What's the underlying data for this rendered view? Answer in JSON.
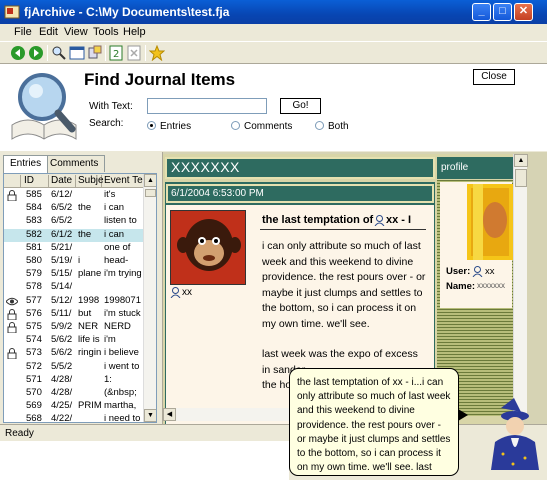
{
  "window": {
    "title": "fjArchive - C:\\My Documents\\test.fja"
  },
  "titlebar_buttons": {
    "minimize": "_",
    "maximize": "□",
    "close": "✕"
  },
  "menu": {
    "file": "File",
    "edit": "Edit",
    "view": "View",
    "tools": "Tools",
    "help": "Help"
  },
  "find": {
    "title": "Find Journal Items",
    "with_text_label": "With Text:",
    "text_value": "",
    "go_label": "Go!",
    "close_label": "Close",
    "search_label": "Search:",
    "options": {
      "entries": "Entries",
      "comments": "Comments",
      "both": "Both"
    },
    "selected": "Entries"
  },
  "tabs": {
    "entries": "Entries",
    "comments": "Comments"
  },
  "list": {
    "columns": {
      "id": "ID",
      "date": "Date",
      "subject": "Subje",
      "event": "Event Te"
    },
    "rows": [
      {
        "icon": "lock",
        "id": "585",
        "date": "6/12/",
        "subject": "",
        "event": "it's"
      },
      {
        "icon": "",
        "id": "584",
        "date": "6/5/2",
        "subject": "the",
        "event": "i can"
      },
      {
        "icon": "",
        "id": "583",
        "date": "6/5/2",
        "subject": "",
        "event": "listen to"
      },
      {
        "icon": "",
        "id": "582",
        "date": "6/1/2",
        "subject": "the",
        "event": "i can"
      },
      {
        "icon": "",
        "id": "581",
        "date": "5/21/",
        "subject": "",
        "event": "one of"
      },
      {
        "icon": "",
        "id": "580",
        "date": "5/19/",
        "subject": "i",
        "event": "head-"
      },
      {
        "icon": "",
        "id": "579",
        "date": "5/15/",
        "subject": "plane",
        "event": "i'm trying"
      },
      {
        "icon": "",
        "id": "578",
        "date": "5/14/",
        "subject": "",
        "event": ""
      },
      {
        "icon": "eye",
        "id": "577",
        "date": "5/12/",
        "subject": "1998",
        "event": "1998071"
      },
      {
        "icon": "lock",
        "id": "576",
        "date": "5/11/",
        "subject": "but",
        "event": "i'm stuck"
      },
      {
        "icon": "lock",
        "id": "575",
        "date": "5/9/2",
        "subject": "NER",
        "event": "NERD"
      },
      {
        "icon": "",
        "id": "574",
        "date": "5/6/2",
        "subject": "life is",
        "event": "i'm"
      },
      {
        "icon": "lock",
        "id": "573",
        "date": "5/6/2",
        "subject": "ringin",
        "event": "i believe"
      },
      {
        "icon": "",
        "id": "572",
        "date": "5/5/2",
        "subject": "",
        "event": "i went to"
      },
      {
        "icon": "",
        "id": "571",
        "date": "4/28/",
        "subject": "",
        "event": "1:"
      },
      {
        "icon": "",
        "id": "570",
        "date": "4/28/",
        "subject": "",
        "event": "(&nbsp;"
      },
      {
        "icon": "",
        "id": "569",
        "date": "4/25/",
        "subject": "PRIM",
        "event": "martha,"
      },
      {
        "icon": "",
        "id": "568",
        "date": "4/22/",
        "subject": "",
        "event": "i need to"
      }
    ],
    "selected_id": "582"
  },
  "journal": {
    "header": "XXXXXXX",
    "profile_tab": "profile",
    "entry_date": "6/1/2004 6:53:00 PM",
    "entry_title": "the last temptation of",
    "entry_title_user": "xx - I",
    "avatar_user": "xx",
    "entry_text": "i can only attribute so much of last week and this weekend to divine providence. the rest pours over - or maybe it just clumps and settles to the bottom, so i can process it on my own time. we'll see.",
    "entry_text_2": "last week was the expo of excess in sandar",
    "entry_text_3": "the hot",
    "profile_user_label": "User:",
    "profile_user": "xx",
    "profile_name_label": "Name:",
    "profile_name": "xxxxxxx"
  },
  "tooltip": {
    "text": "the last temptation of xx - i...i can only attribute so much of last week and this weekend to divine providence. the rest pours over - or maybe it just clumps and settles to the bottom, so i can process it on my own time. we'll see. last"
  },
  "status": {
    "text": "Ready"
  },
  "colors": {
    "titlebar": "#0846b3",
    "journal_header": "#2e6b60",
    "selected_row": "#c6e6ec",
    "tooltip_bg": "#ffffe1"
  }
}
